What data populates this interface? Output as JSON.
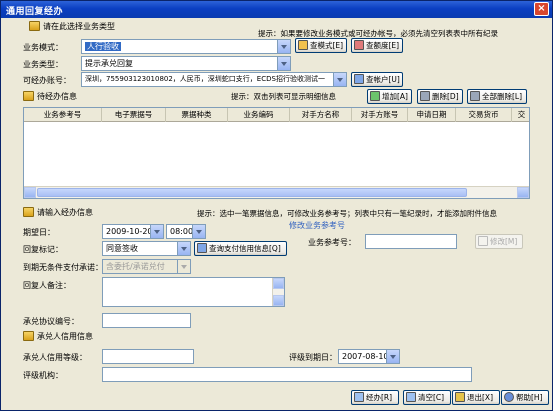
{
  "window": {
    "title": "通用回复经办"
  },
  "section_business_type": {
    "label": "请在此选择业务类型"
  },
  "hint_top": "提示：如果要修改业务模式或可经办帐号，必须先清空列表表中所有纪录",
  "business_mode": {
    "label": "业务模式：",
    "value": "人行验收"
  },
  "business_category": {
    "label": "业务类型：",
    "value": "提示承兑回复"
  },
  "account": {
    "label": "可经办账号：",
    "value": "深圳，755903123010802，人民币，深圳蛇口支行，ECDS招行验收测试一"
  },
  "buttons_top": {
    "view_mode": "查模式[E]",
    "view_limit": "查额度[E]",
    "view_account": "查帐户[U]"
  },
  "section_pending": {
    "label": "待经办信息"
  },
  "hint_list": "提示：双击列表可显示明细信息",
  "buttons_list": {
    "add": "增加[A]",
    "delete": "删除[D]",
    "delete_all": "全部删除[L]"
  },
  "table": {
    "columns": [
      "业务参考号",
      "电子票据号",
      "票据种类",
      "业务编码",
      "对手方名称",
      "对手方账号",
      "申请日期",
      "交易货币",
      "交"
    ]
  },
  "section_input": {
    "label": "请输入经办信息"
  },
  "hint_input": "提示：选中一笔票据信息，可修改业务参考号；列表中只有一笔纪录时，才能添加附件信息",
  "expected_date": {
    "label": "期望日：",
    "date": "2009-10-20",
    "time": "08:00"
  },
  "reply_flag": {
    "label": "回复标记：",
    "value": "同意签收",
    "view_credit_button": "查询支付信用信息[Q]"
  },
  "unconditional_pay": {
    "label": "到期无条件支付承诺：",
    "value": "含委托/承诺兑付"
  },
  "remark": {
    "label": "回复人备注："
  },
  "agreement_no": {
    "label": "承兑协议编号："
  },
  "modify_ref": {
    "group_title": "修改业务参考号",
    "label": "业务参考号：",
    "modify_button": "修改[M]"
  },
  "section_credit": {
    "label": "承兑人信用信息"
  },
  "credit_grade": {
    "label": "承兑人信用等级："
  },
  "rating_expiry": {
    "label": "评级到期日：",
    "value": "2007-08-10"
  },
  "rating_agency": {
    "label": "评级机构："
  },
  "footer_buttons": {
    "submit": "经办[R]",
    "clear": "清空[C]",
    "exit": "退出[X]",
    "help": "帮助[H]"
  }
}
